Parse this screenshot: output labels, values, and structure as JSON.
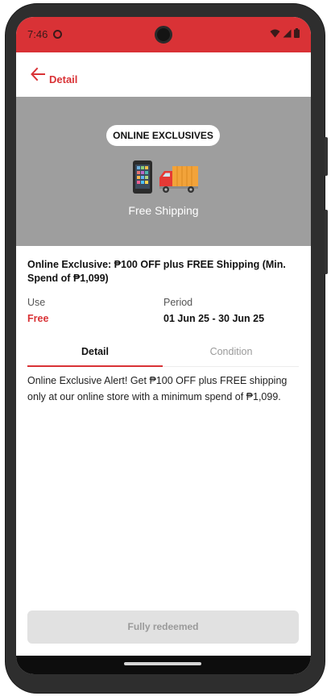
{
  "status_bar": {
    "time": "7:46"
  },
  "header": {
    "title": "Detail"
  },
  "banner": {
    "badge": "ONLINE EXCLUSIVES",
    "caption": "Free Shipping"
  },
  "offer": {
    "title": "Online Exclusive: ₱100 OFF plus FREE Shipping (Min. Spend of ₱1,099)",
    "use_label": "Use",
    "use_value": "Free",
    "period_label": "Period",
    "period_value": "01 Jun 25 - 30 Jun 25"
  },
  "tabs": {
    "detail": "Detail",
    "condition": "Condition"
  },
  "description": "Online Exclusive Alert! Get ₱100 OFF plus FREE shipping only at our online store with a minimum spend of ₱1,099.",
  "action": {
    "label": "Fully redeemed"
  },
  "colors": {
    "accent": "#d93236",
    "banner_bg": "#9e9e9e",
    "disabled_bg": "#e1e1e1",
    "disabled_text": "#9a9a9a"
  }
}
